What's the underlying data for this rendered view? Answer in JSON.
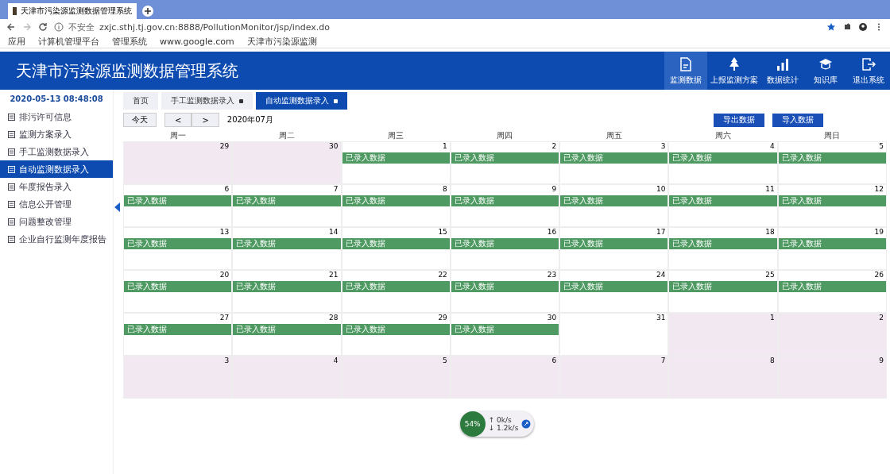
{
  "browser": {
    "tab_title": "天津市污染源监测数据管理系统",
    "url_prefix": "不安全",
    "url": "zxjc.sthj.tj.gov.cn:8888/PollutionMonitor/jsp/index.do",
    "bookmarks": [
      "应用",
      "计算机管理平台",
      "管理系统",
      "www.google.com",
      "天津市污染源监测"
    ]
  },
  "header": {
    "title": "天津市污染源监测数据管理系统",
    "actions": [
      {
        "kind": "doc",
        "label": "监测数据",
        "selected": true
      },
      {
        "kind": "tree",
        "label": "上报监测方案",
        "selected": false
      },
      {
        "kind": "chart",
        "label": "数据统计",
        "selected": false
      },
      {
        "kind": "hat",
        "label": "知识库",
        "selected": false
      },
      {
        "kind": "exit",
        "label": "退出系统",
        "selected": false
      }
    ]
  },
  "sidebar": {
    "datetime": "2020-05-13 08:48:08",
    "items": [
      {
        "label": "排污许可信息",
        "selected": false
      },
      {
        "label": "监测方案录入",
        "selected": false
      },
      {
        "label": "手工监测数据录入",
        "selected": false
      },
      {
        "label": "自动监测数据录入",
        "selected": true
      },
      {
        "label": "年度报告录入",
        "selected": false
      },
      {
        "label": "信息公开管理",
        "selected": false
      },
      {
        "label": "问题整改管理",
        "selected": false
      },
      {
        "label": "企业自行监测年度报告",
        "selected": false
      }
    ]
  },
  "tabs": [
    {
      "label": "首页",
      "selected": false,
      "closable": false
    },
    {
      "label": "手工监测数据录入",
      "selected": false,
      "closable": true
    },
    {
      "label": "自动监测数据录入",
      "selected": true,
      "closable": true
    }
  ],
  "toolbar": {
    "today": "今天",
    "prev": "<",
    "next": ">",
    "month": "2020年07月",
    "buttons": [
      "导出数据",
      "导入数据"
    ]
  },
  "weekdays": [
    "周一",
    "周二",
    "周三",
    "周四",
    "周五",
    "周六",
    "周日"
  ],
  "weeks": [
    [
      {
        "day": "29",
        "other_month": true
      },
      {
        "day": "30",
        "other_month": true
      },
      {
        "day": "1",
        "other_month": false,
        "event": "已录入数据"
      },
      {
        "day": "2",
        "other_month": false,
        "event": "已录入数据"
      },
      {
        "day": "3",
        "other_month": false,
        "event": "已录入数据"
      },
      {
        "day": "4",
        "other_month": false,
        "event": "已录入数据"
      },
      {
        "day": "5",
        "other_month": false,
        "event": "已录入数据"
      }
    ],
    [
      {
        "day": "6",
        "other_month": false,
        "event": "已录入数据"
      },
      {
        "day": "7",
        "other_month": false,
        "event": "已录入数据"
      },
      {
        "day": "8",
        "other_month": false,
        "event": "已录入数据"
      },
      {
        "day": "9",
        "other_month": false,
        "event": "已录入数据"
      },
      {
        "day": "10",
        "other_month": false,
        "event": "已录入数据"
      },
      {
        "day": "11",
        "other_month": false,
        "event": "已录入数据"
      },
      {
        "day": "12",
        "other_month": false,
        "event": "已录入数据"
      }
    ],
    [
      {
        "day": "13",
        "other_month": false,
        "event": "已录入数据"
      },
      {
        "day": "14",
        "other_month": false,
        "event": "已录入数据"
      },
      {
        "day": "15",
        "other_month": false,
        "event": "已录入数据"
      },
      {
        "day": "16",
        "other_month": false,
        "event": "已录入数据"
      },
      {
        "day": "17",
        "other_month": false,
        "event": "已录入数据"
      },
      {
        "day": "18",
        "other_month": false,
        "event": "已录入数据"
      },
      {
        "day": "19",
        "other_month": false,
        "event": "已录入数据"
      }
    ],
    [
      {
        "day": "20",
        "other_month": false,
        "event": "已录入数据"
      },
      {
        "day": "21",
        "other_month": false,
        "event": "已录入数据"
      },
      {
        "day": "22",
        "other_month": false,
        "event": "已录入数据"
      },
      {
        "day": "23",
        "other_month": false,
        "event": "已录入数据"
      },
      {
        "day": "24",
        "other_month": false,
        "event": "已录入数据"
      },
      {
        "day": "25",
        "other_month": false,
        "event": "已录入数据"
      },
      {
        "day": "26",
        "other_month": false,
        "event": "已录入数据"
      }
    ],
    [
      {
        "day": "27",
        "other_month": false,
        "event": "已录入数据"
      },
      {
        "day": "28",
        "other_month": false,
        "event": "已录入数据"
      },
      {
        "day": "29",
        "other_month": false,
        "event": "已录入数据"
      },
      {
        "day": "30",
        "other_month": false,
        "event": "已录入数据"
      },
      {
        "day": "31",
        "other_month": false
      },
      {
        "day": "1",
        "other_month": true
      },
      {
        "day": "2",
        "other_month": true
      }
    ],
    [
      {
        "day": "3",
        "other_month": true
      },
      {
        "day": "4",
        "other_month": true
      },
      {
        "day": "5",
        "other_month": true
      },
      {
        "day": "6",
        "other_month": true
      },
      {
        "day": "7",
        "other_month": true
      },
      {
        "day": "8",
        "other_month": true
      },
      {
        "day": "9",
        "other_month": true
      }
    ]
  ],
  "speed_widget": {
    "percent": "54%",
    "up": "↑ 0k/s",
    "down": "↓ 1.2k/s"
  }
}
